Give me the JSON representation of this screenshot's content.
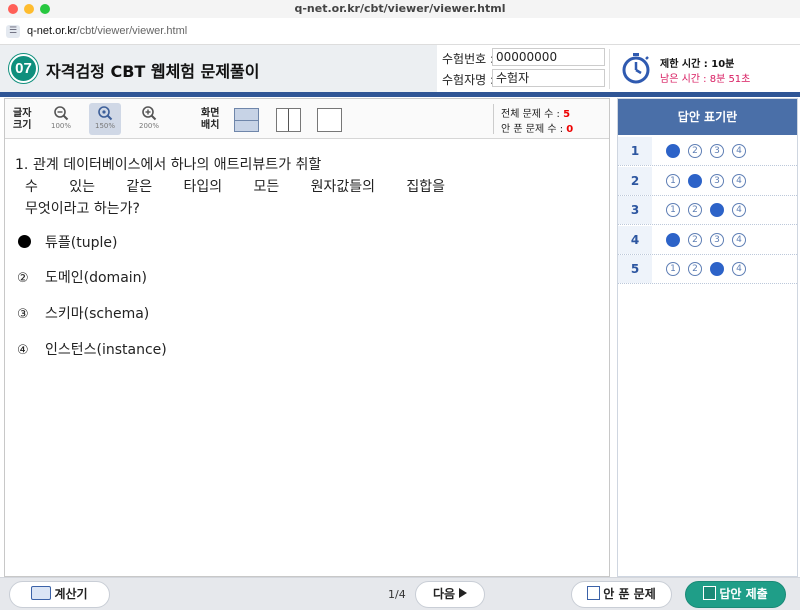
{
  "browser": {
    "window_title": "q-net.or.kr/cbt/viewer/viewer.html",
    "url_domain": "q-net.or.kr",
    "url_path": "/cbt/viewer/viewer.html"
  },
  "header": {
    "number_badge": "07",
    "title": "자격검정 CBT 웹체험 문제풀이",
    "exam_number_label": "수험번호 :",
    "exam_number_value": "00000000",
    "examinee_label": "수험자명 :",
    "examinee_value": "수험자",
    "time_limit": "제한 시간 : 10분",
    "time_left": "남은 시간 : 8분 51초",
    "colors": {
      "badge": "#0f8f7d",
      "bar": "#2f5595",
      "time_left": "#d81b60"
    }
  },
  "toolbar": {
    "font_size_label": [
      "글자",
      "크기"
    ],
    "zoom_options": [
      {
        "label": "100%",
        "icon": "zoom-out-icon",
        "active": false
      },
      {
        "label": "150%",
        "icon": "zoom-reset-icon",
        "active": true
      },
      {
        "label": "200%",
        "icon": "zoom-in-icon",
        "active": false
      }
    ],
    "screen_layout_label": [
      "화면",
      "배치"
    ],
    "layouts": [
      "single-column-layout",
      "two-column-layout",
      "full-page-layout"
    ],
    "total_questions_label": "전체 문제 수 :",
    "total_questions_value": "5",
    "unanswered_label": "안 푼 문제 수 :",
    "unanswered_value": "0"
  },
  "question": {
    "number": "1.",
    "lines": [
      "관계 데이터베이스에서 하나의 애트리뷰트가 취할",
      "수 있는 같은 타입의 모든 원자값들의 집합을",
      "무엇이라고 하는가?"
    ],
    "choices": [
      {
        "marker": "●",
        "text": "튜플(tuple)",
        "selected": true
      },
      {
        "marker": "②",
        "text": "도메인(domain)",
        "selected": false
      },
      {
        "marker": "③",
        "text": "스키마(schema)",
        "selected": false
      },
      {
        "marker": "④",
        "text": "인스턴스(instance)",
        "selected": false
      }
    ]
  },
  "answer_sheet": {
    "title": "답안 표기란",
    "rows": [
      {
        "num": "1",
        "selected": 1
      },
      {
        "num": "2",
        "selected": 2
      },
      {
        "num": "3",
        "selected": 3
      },
      {
        "num": "4",
        "selected": 1
      },
      {
        "num": "5",
        "selected": 3
      }
    ],
    "option_labels": [
      "①",
      "②",
      "③",
      "④"
    ]
  },
  "footer": {
    "calculator": "계산기",
    "page_indicator": "1/4",
    "next": "다음",
    "unanswered_button": "안 푼 문제",
    "submit": "답안 제출"
  }
}
